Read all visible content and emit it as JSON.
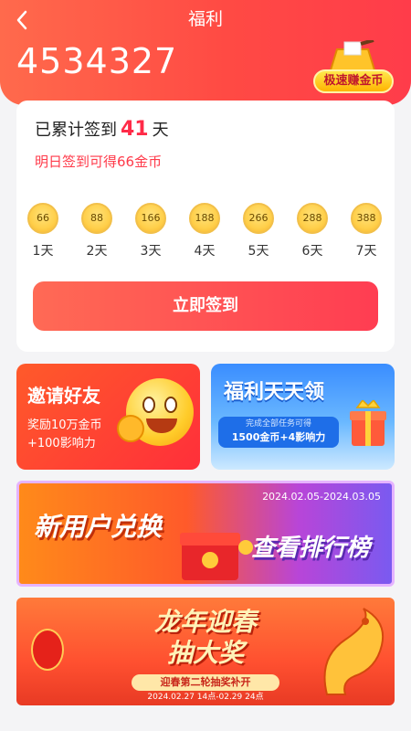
{
  "header": {
    "back_icon": "chevron-left-icon",
    "title": "福利",
    "coins": "4534327",
    "speed_label": "极速赚金币"
  },
  "checkin": {
    "streak_prefix": "已累计签到",
    "streak_days": "41",
    "streak_suffix": "天",
    "tomorrow": "明日签到可得66金币",
    "days": [
      {
        "coins": "66",
        "label": "1天"
      },
      {
        "coins": "88",
        "label": "2天"
      },
      {
        "coins": "166",
        "label": "3天"
      },
      {
        "coins": "188",
        "label": "4天"
      },
      {
        "coins": "266",
        "label": "5天"
      },
      {
        "coins": "288",
        "label": "6天"
      },
      {
        "coins": "388",
        "label": "7天"
      }
    ],
    "button_label": "立即签到"
  },
  "invite": {
    "title": "邀请好友",
    "line1": "奖励10万金币",
    "line2": "+100影响力"
  },
  "daily": {
    "title": "福利天天领",
    "small": "完成全部任务可得",
    "reward": "1500金币+4影响力"
  },
  "banner_new_user": {
    "date": "2024.02.05-2024.03.05",
    "title": "新用户兑换",
    "action": "查看排行榜"
  },
  "banner_spring": {
    "line1": "龙年迎春",
    "line2": "抽大奖",
    "subtitle": "迎春第二轮抽奖补开",
    "date": "2024.02.27 14点-02.29 24点"
  },
  "colors": {
    "accent": "#ff3d52",
    "coin_gold": "#ffcf4a",
    "daily_blue": "#3a8dff"
  }
}
